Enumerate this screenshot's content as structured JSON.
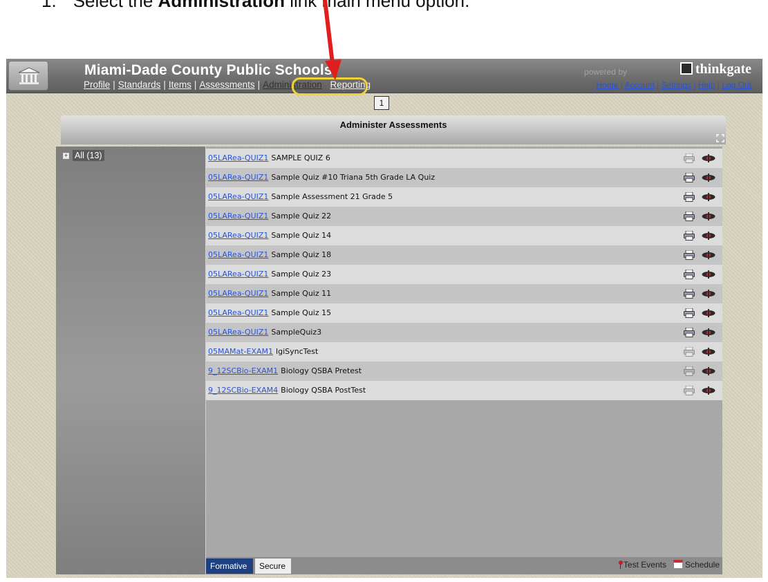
{
  "instruction": {
    "number": "1.",
    "prefix": "Select the ",
    "bold": "Administration",
    "suffix": " link main menu option."
  },
  "header": {
    "site_title": "Miami-Dade County Public Schools",
    "nav": [
      "Profile",
      "Standards",
      "Items",
      "Assessments",
      "Administration",
      "Reporting"
    ],
    "powered_by": "powered by",
    "brand": "thinkgate",
    "user_nav": [
      "Home",
      "Account",
      "Settings",
      "Help",
      "Log Out"
    ],
    "callout": "1"
  },
  "panel": {
    "title": "Administer Assessments"
  },
  "tree": {
    "toggle": "+",
    "label": "All (13)"
  },
  "assessments": [
    {
      "code": "05LARea-QUIZ1",
      "name": "SAMPLE QUIZ 6",
      "print_enabled": false
    },
    {
      "code": "05LARea-QUIZ1",
      "name": "Sample Quiz #10 Triana 5th Grade LA Quiz",
      "print_enabled": true
    },
    {
      "code": "05LARea-QUIZ1",
      "name": "Sample Assessment 21 Grade 5",
      "print_enabled": true
    },
    {
      "code": "05LARea-QUIZ1",
      "name": "Sample Quiz 22",
      "print_enabled": true
    },
    {
      "code": "05LARea-QUIZ1",
      "name": "Sample Quiz 14",
      "print_enabled": true
    },
    {
      "code": "05LARea-QUIZ1",
      "name": "Sample Quiz 18",
      "print_enabled": true
    },
    {
      "code": "05LARea-QUIZ1",
      "name": "Sample Quiz 23",
      "print_enabled": true
    },
    {
      "code": "05LARea-QUIZ1",
      "name": "Sample Quiz 11",
      "print_enabled": true
    },
    {
      "code": "05LARea-QUIZ1",
      "name": "Sample Quiz 15",
      "print_enabled": true
    },
    {
      "code": "05LARea-QUIZ1",
      "name": "SampleQuiz3",
      "print_enabled": true
    },
    {
      "code": "05MAMat-EXAM1",
      "name": "lgiSyncTest",
      "print_enabled": false
    },
    {
      "code": "9_12SCBio-EXAM1",
      "name": "Biology QSBA Pretest",
      "print_enabled": false
    },
    {
      "code": "9_12SCBio-EXAM4",
      "name": "Biology QSBA PostTest",
      "print_enabled": false
    }
  ],
  "bottom": {
    "tabs": [
      "Formative",
      "Secure"
    ],
    "test_events": "Test Events",
    "schedule": "Schedule"
  },
  "colors": {
    "highlight_ring": "#f1d23a",
    "arrow": "#e01e1e",
    "link": "#2a54d6",
    "active_tab": "#1e3f80"
  }
}
